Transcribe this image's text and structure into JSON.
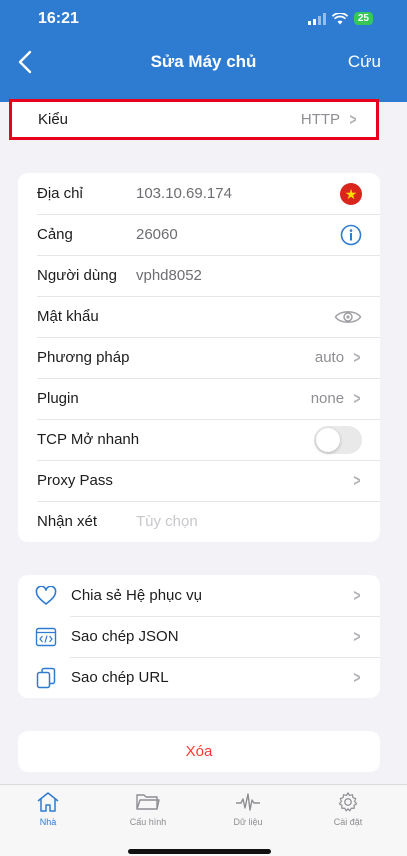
{
  "status": {
    "time": "16:21",
    "battery": "25"
  },
  "nav": {
    "title": "Sửa Máy chủ",
    "save_label": "Cứu"
  },
  "type_row": {
    "label": "Kiểu",
    "value": "HTTP"
  },
  "fields": {
    "address": {
      "label": "Địa chỉ",
      "value": "103.10.69.174"
    },
    "port": {
      "label": "Cảng",
      "value": "26060"
    },
    "username": {
      "label": "Người dùng",
      "value": "vphd8052"
    },
    "password": {
      "label": "Mật khẩu",
      "value": ""
    },
    "method": {
      "label": "Phương pháp",
      "value": "auto"
    },
    "plugin": {
      "label": "Plugin",
      "value": "none"
    },
    "tcp_fast_open": {
      "label": "TCP Mở nhanh",
      "enabled": false
    },
    "proxy_pass": {
      "label": "Proxy Pass"
    },
    "remark": {
      "label": "Nhận xét",
      "placeholder": "Tùy chọn"
    }
  },
  "actions": {
    "share": "Chia sẻ Hệ phục vụ",
    "copy_json": "Sao chép JSON",
    "copy_url": "Sao chép URL"
  },
  "delete_label": "Xóa",
  "tabs": {
    "home": "Nhà",
    "config": "Cấu hình",
    "data": "Dữ liệu",
    "settings": "Cài đặt"
  },
  "colors": {
    "accent": "#2e7bd2",
    "highlight_border": "#e8001c",
    "danger": "#ff3b30"
  }
}
